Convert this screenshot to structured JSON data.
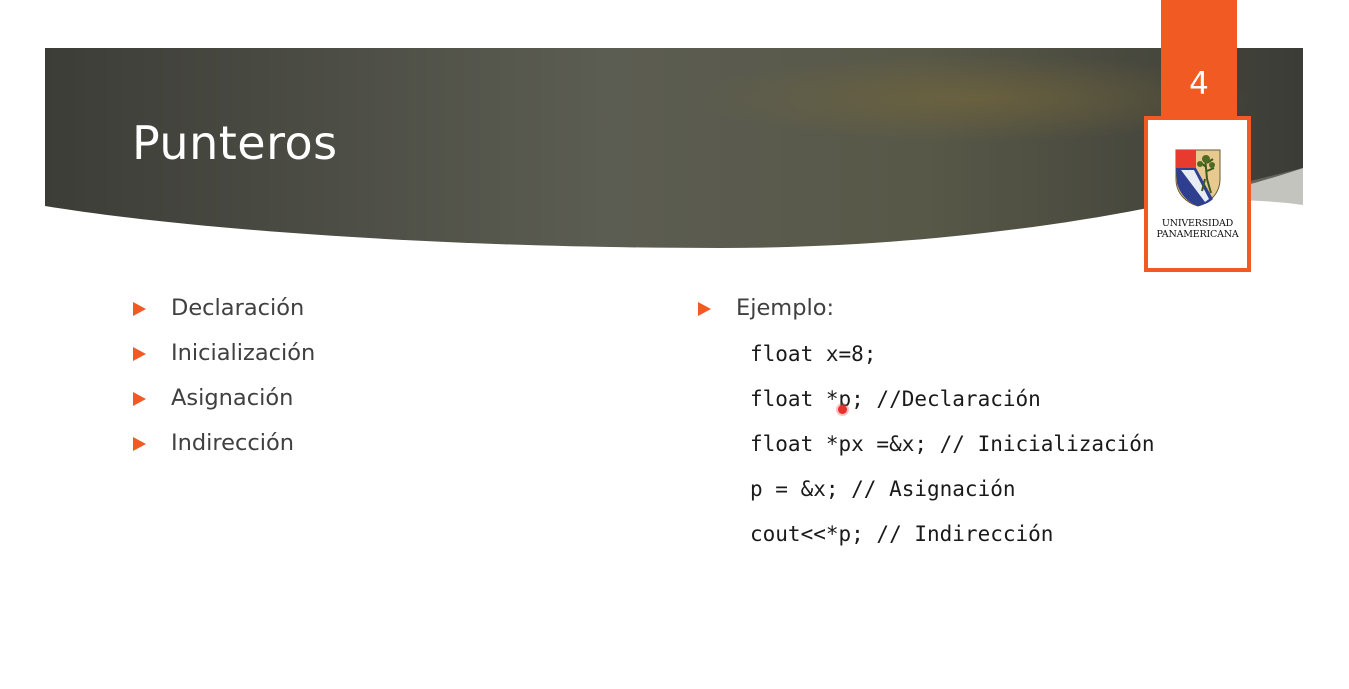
{
  "slide": {
    "title": "Punteros",
    "page_number": "4",
    "logo": {
      "name": "UNIVERSIDAD PANAMERICANA",
      "line1": "UNIVERSIDAD",
      "line2": "PANAMERICANA"
    },
    "left_bullets": [
      "Declaración",
      "Inicialización",
      "Asignación",
      "Indirección"
    ],
    "right_bullet": "Ejemplo:",
    "code_lines": [
      "float x=8;",
      "float *p; //Declaración",
      "float *px =&x; // Inicialización",
      "p = &x; // Asignación",
      "cout<<*p; // Indirección"
    ]
  },
  "colors": {
    "accent": "#f15a22",
    "banner_dark": "#3d3f38",
    "banner_light": "#6b6b5a",
    "title_text": "#ffffff",
    "body_text": "#404040"
  }
}
